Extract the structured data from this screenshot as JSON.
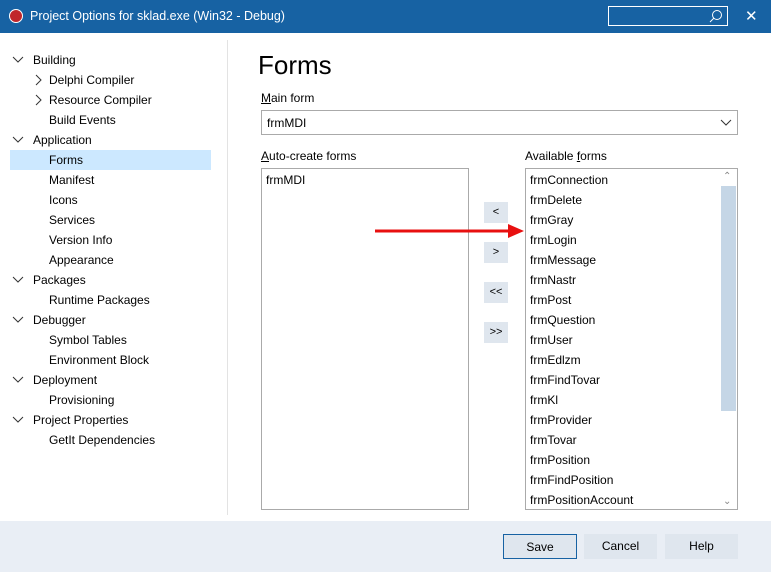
{
  "window": {
    "title": "Project Options for sklad.exe  (Win32 - Debug)",
    "close": "✕",
    "search_icon": "search-icon",
    "accent": "#1762a3"
  },
  "tree": [
    {
      "label": "Building",
      "level": 0,
      "expanded": true
    },
    {
      "label": "Delphi Compiler",
      "level": 1,
      "collapsed": true
    },
    {
      "label": "Resource Compiler",
      "level": 1,
      "collapsed": true
    },
    {
      "label": "Build Events",
      "level": 1
    },
    {
      "label": "Application",
      "level": 0,
      "expanded": true
    },
    {
      "label": "Forms",
      "level": 1,
      "selected": true
    },
    {
      "label": "Manifest",
      "level": 1
    },
    {
      "label": "Icons",
      "level": 1
    },
    {
      "label": "Services",
      "level": 1
    },
    {
      "label": "Version Info",
      "level": 1
    },
    {
      "label": "Appearance",
      "level": 1
    },
    {
      "label": "Packages",
      "level": 0,
      "expanded": true
    },
    {
      "label": "Runtime Packages",
      "level": 1
    },
    {
      "label": "Debugger",
      "level": 0,
      "expanded": true
    },
    {
      "label": "Symbol Tables",
      "level": 1
    },
    {
      "label": "Environment Block",
      "level": 1
    },
    {
      "label": "Deployment",
      "level": 0,
      "expanded": true
    },
    {
      "label": "Provisioning",
      "level": 1
    },
    {
      "label": "Project Properties",
      "level": 0,
      "expanded": true
    },
    {
      "label": "GetIt Dependencies",
      "level": 1
    }
  ],
  "main": {
    "heading": "Forms",
    "main_form_label_key": "M",
    "main_form_label_rest": "ain form",
    "main_form_value": "frmMDI",
    "auto_label_key": "A",
    "auto_label_rest": "uto-create forms",
    "auto_forms": [
      "frmMDI"
    ],
    "avail_label_pre": "Available ",
    "avail_label_key": "f",
    "avail_label_rest": "orms",
    "available_forms": [
      "frmConnection",
      "frmDelete",
      "frmGray",
      "frmLogin",
      "frmMessage",
      "frmNastr",
      "frmPost",
      "frmQuestion",
      "frmUser",
      "frmEdlzm",
      "frmFindTovar",
      "frmKl",
      "frmProvider",
      "frmTovar",
      "frmPosition",
      "frmFindPosition",
      "frmPositionAccount"
    ],
    "move_buttons": [
      "<",
      ">",
      "<<",
      ">>"
    ]
  },
  "footer": {
    "save": "Save",
    "cancel": "Cancel",
    "help": "Help"
  },
  "annotation": {
    "arrow_color": "#e81010"
  }
}
